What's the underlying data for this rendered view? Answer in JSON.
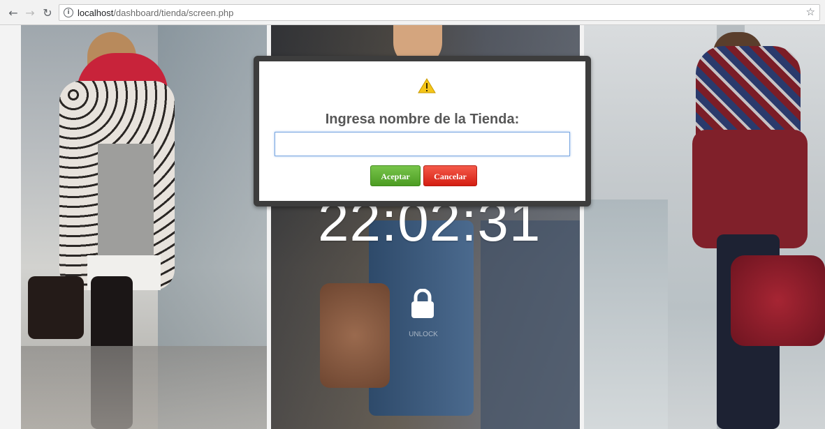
{
  "browser": {
    "url_host": "localhost",
    "url_path": "/dashboard/tienda/screen.php",
    "back_icon": "back-arrow-icon",
    "forward_icon": "forward-arrow-icon",
    "reload_icon": "reload-icon",
    "info_icon": "info-icon",
    "bookmark_icon": "star-icon"
  },
  "lockscreen": {
    "time": "22:02:31",
    "lock_icon": "lock-icon",
    "caption": "UNLOCK"
  },
  "dialog": {
    "icon": "warning-icon",
    "title": "Ingresa nombre de la Tienda:",
    "input_value": "",
    "accept_label": "Aceptar",
    "cancel_label": "Cancelar"
  },
  "colors": {
    "accept": "#4c9c23",
    "cancel": "#d41e12",
    "dialog_border": "#3d3d3d",
    "input_focus": "#7aa7e0"
  }
}
